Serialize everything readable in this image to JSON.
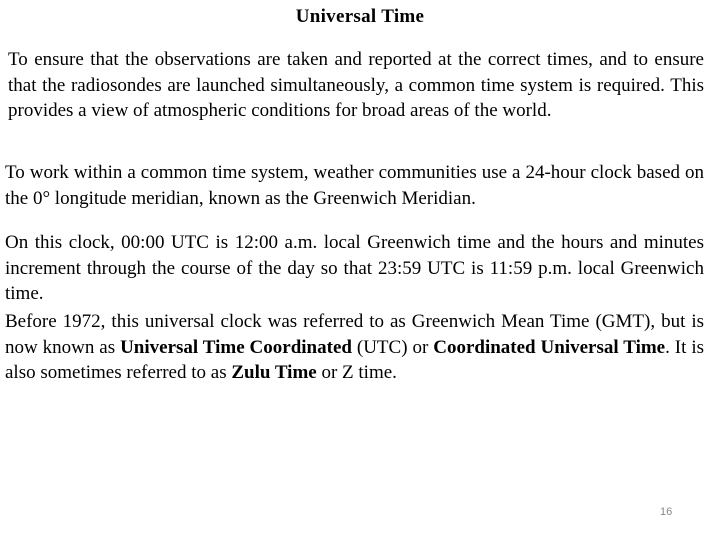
{
  "slide": {
    "title": "Universal Time",
    "page_number": "16"
  },
  "paragraphs": {
    "p1": "To ensure that the observations are taken and reported at the correct times, and to ensure that the radiosondes are launched simultaneously, a common time system is required. This provides a view of atmospheric conditions for broad areas of the world.",
    "p2": "To work within a common time system, weather communities use a 24-hour clock based on the 0° longitude meridian, known as the Greenwich Meridian.",
    "p3": "On this clock, 00:00 UTC is 12:00 a.m. local Greenwich time and the hours and minutes increment through the course of the day so that 23:59 UTC is 11:59 p.m. local Greenwich time.",
    "p4": {
      "part1": "Before 1972, this universal clock was referred to as Greenwich Mean Time (GMT), but is now known as ",
      "bold1": "Universal Time Coordinated",
      "part2": " (UTC) or ",
      "bold2": "Coordinated Universal Time",
      "part3": ". It is also sometimes referred to as ",
      "bold3": "Zulu Time",
      "part4": " or Z time."
    }
  }
}
